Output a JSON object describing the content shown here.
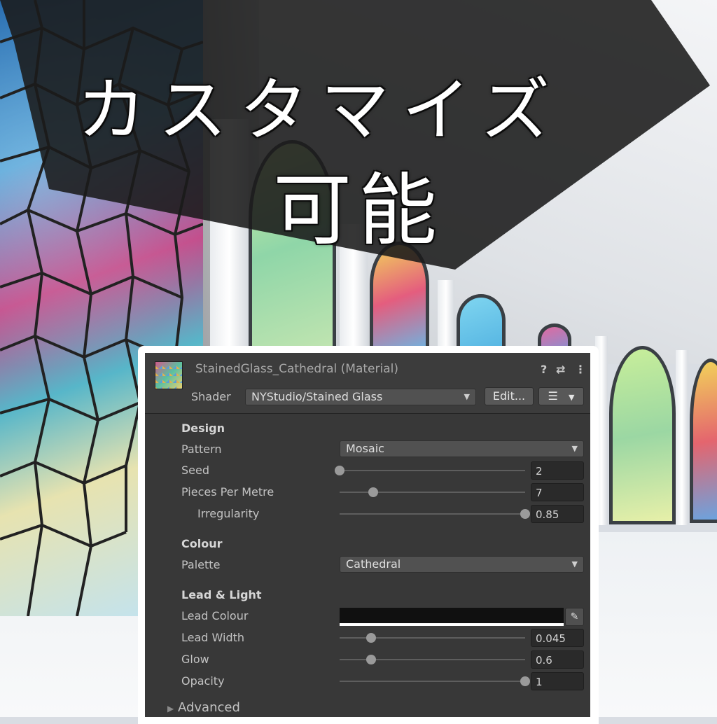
{
  "banner": {
    "line1": "カスタマイズ",
    "line2": "可能"
  },
  "header": {
    "material_title": "StainedGlass_Cathedral (Material)",
    "help_icon": "?",
    "settings_icon": "⇄",
    "menu_icon": "⋮",
    "shader_label": "Shader",
    "shader_value": "NYStudio/Stained Glass",
    "edit_label": "Edit...",
    "list_icon": "☰"
  },
  "design": {
    "section_label": "Design",
    "pattern": {
      "label": "Pattern",
      "value": "Mosaic"
    },
    "seed": {
      "label": "Seed",
      "value": "2",
      "fraction": 0.0
    },
    "pieces_per_metre": {
      "label": "Pieces Per Metre",
      "value": "7",
      "fraction": 0.18
    },
    "irregularity": {
      "label": "Irregularity",
      "value": "0.85",
      "fraction": 1.0
    }
  },
  "colour": {
    "section_label": "Colour",
    "palette": {
      "label": "Palette",
      "value": "Cathedral"
    }
  },
  "lead_light": {
    "section_label": "Lead & Light",
    "lead_colour": {
      "label": "Lead Colour",
      "color": "#101010"
    },
    "lead_width": {
      "label": "Lead Width",
      "value": "0.045",
      "fraction": 0.17
    },
    "glow": {
      "label": "Glow",
      "value": "0.6",
      "fraction": 0.17
    },
    "opacity": {
      "label": "Opacity",
      "value": "1",
      "fraction": 1.0
    }
  },
  "advanced": {
    "label": "Advanced",
    "icon": "▶"
  },
  "colors": {
    "inspector_bg": "#383838",
    "banner_bg": "#1a1a1a",
    "text": "#c4c4c4"
  }
}
